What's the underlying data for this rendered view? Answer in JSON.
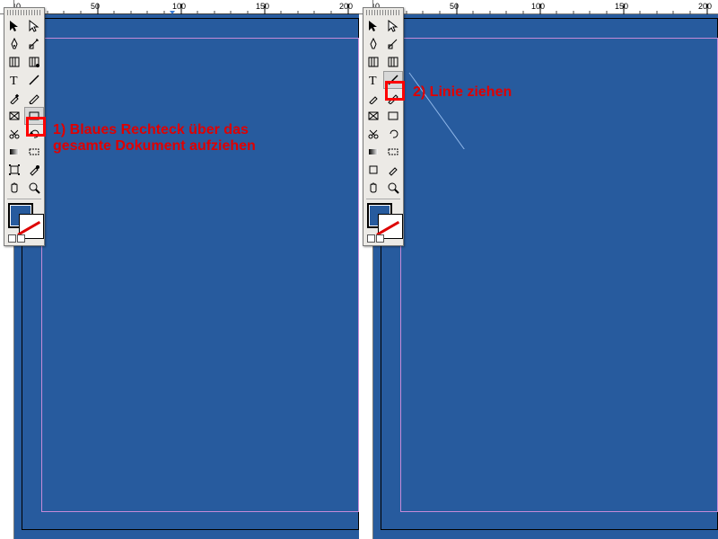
{
  "annotations": {
    "a1": "1) Blaues Rechteck über das gesamte Dokument aufziehen",
    "a2": "2) Linie ziehen"
  },
  "ruler": {
    "ticks": [
      "0",
      "50",
      "100",
      "150",
      "200"
    ]
  },
  "tools": {
    "row1": [
      "selection-tool",
      "direct-selection-tool"
    ],
    "row2": [
      "pen-tool",
      "shear-tool"
    ],
    "row3": [
      "column-guides-tool",
      "column-guides-tool-2"
    ],
    "row4": [
      "type-tool",
      "line-tool"
    ],
    "row5": [
      "eyedropper-tool",
      "pencil-tool"
    ],
    "row6": [
      "frame-tool",
      "rectangle-tool"
    ],
    "row7": [
      "scissors-tool",
      "rotate-tool"
    ],
    "row8": [
      "gradient-tool",
      "gradient-swatch-tool"
    ],
    "row9": [
      "free-transform-tool",
      "color-picker-tool"
    ],
    "row10": [
      "hand-tool",
      "zoom-tool"
    ]
  },
  "highlights": {
    "left_tool": "rectangle-tool",
    "right_tool": "line-tool"
  },
  "colors": {
    "canvas": "#275b9e",
    "margin": "#c58bd8",
    "highlight": "#f00",
    "annotation": "#e00000"
  }
}
